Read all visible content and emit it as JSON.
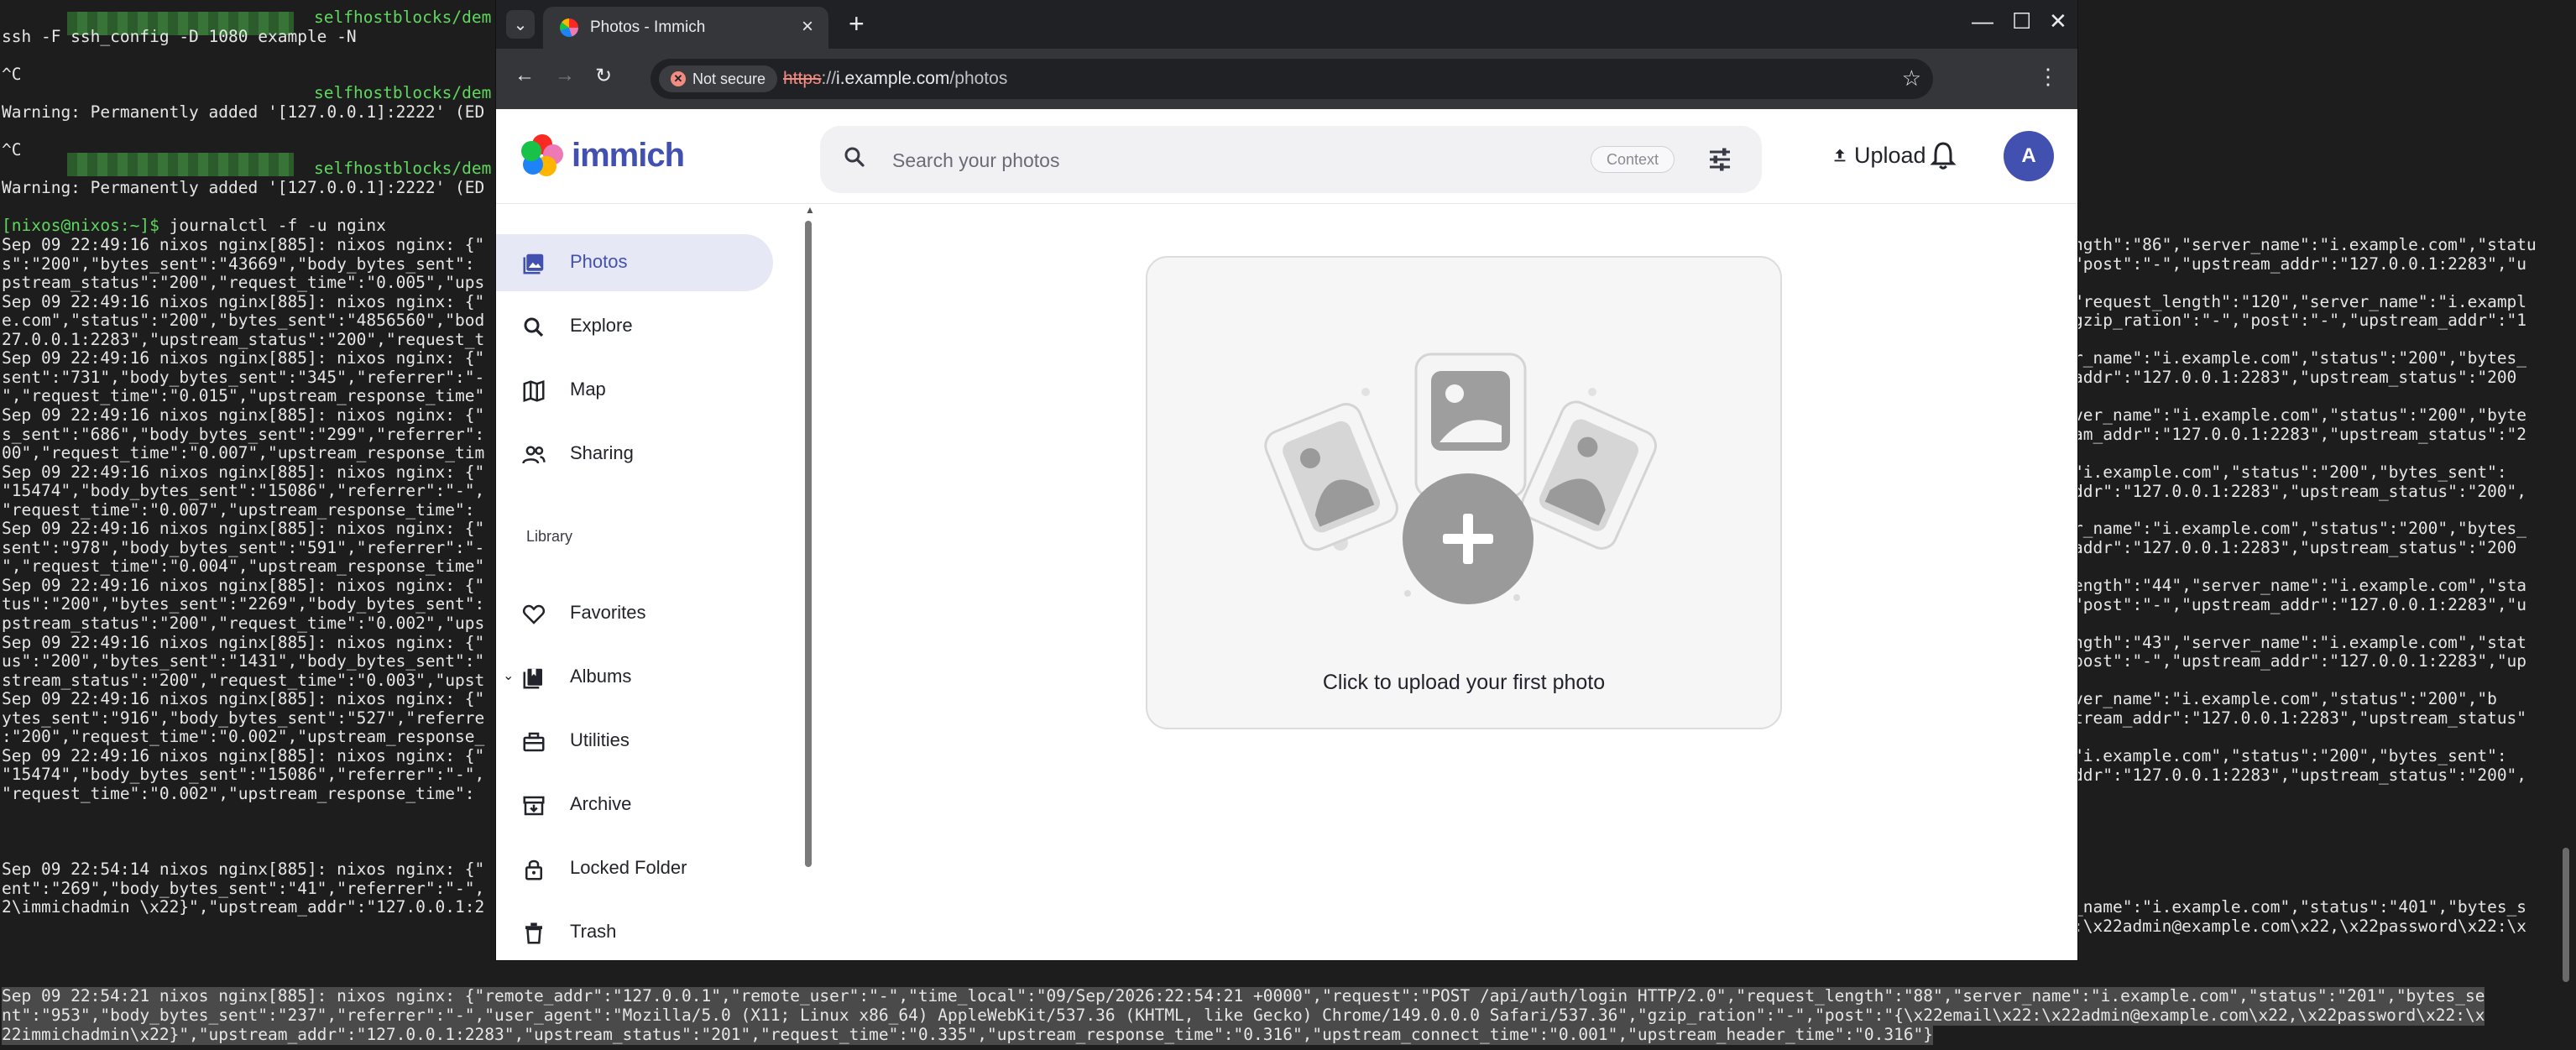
{
  "terminal": {
    "lines": [
      "ssh -F ssh_config -D 1080 example -N",
      "^C",
      "Warning: Permanently added '[127.0.0.1]:2222' (ED",
      "^C",
      "Warning: Permanently added '[127.0.0.1]:2222' (ED",
      "journalctl -f -u nginx",
      "Sep 09 22:49:16 nixos nginx[885]: nixos nginx: {\"",
      "s\":\"200\",\"bytes_sent\":\"43669\",\"body_bytes_sent\":",
      "pstream_status\":\"200\",\"request_time\":\"0.005\",\"ups",
      "Sep 09 22:49:16 nixos nginx[885]: nixos nginx: {\"",
      "e.com\",\"status\":\"200\",\"bytes_sent\":\"4856560\",\"bod",
      "27.0.0.1:2283\",\"upstream_status\":\"200\",\"request_t",
      "Sep 09 22:49:16 nixos nginx[885]: nixos nginx: {\"",
      "sent\":\"731\",\"body_bytes_sent\":\"345\",\"referrer\":\"-",
      "\",\"request_time\":\"0.015\",\"upstream_response_time\"",
      "Sep 09 22:49:16 nixos nginx[885]: nixos nginx: {\"",
      "s_sent\":\"686\",\"body_bytes_sent\":\"299\",\"referrer\":",
      "00\",\"request_time\":\"0.007\",\"upstream_response_tim",
      "Sep 09 22:49:16 nixos nginx[885]: nixos nginx: {\"",
      "\"15474\",\"body_bytes_sent\":\"15086\",\"referrer\":\"-\",",
      "\"request_time\":\"0.007\",\"upstream_response_time\":",
      "Sep 09 22:49:16 nixos nginx[885]: nixos nginx: {\"",
      "sent\":\"978\",\"body_bytes_sent\":\"591\",\"referrer\":\"-",
      "\",\"request_time\":\"0.004\",\"upstream_response_time\"",
      "Sep 09 22:49:16 nixos nginx[885]: nixos nginx: {\"",
      "tus\":\"200\",\"bytes_sent\":\"2269\",\"body_bytes_sent\":",
      "pstream_status\":\"200\",\"request_time\":\"0.002\",\"ups",
      "Sep 09 22:49:16 nixos nginx[885]: nixos nginx: {\"",
      "us\":\"200\",\"bytes_sent\":\"1431\",\"body_bytes_sent\":\"",
      "stream_status\":\"200\",\"request_time\":\"0.003\",\"upst",
      "Sep 09 22:49:16 nixos nginx[885]: nixos nginx: {\"",
      "ytes_sent\":\"916\",\"body_bytes_sent\":\"527\",\"referre",
      ":\"200\",\"request_time\":\"0.002\",\"upstream_response_",
      "Sep 09 22:49:16 nixos nginx[885]: nixos nginx: {\"",
      "\"15474\",\"body_bytes_sent\":\"15086\",\"referrer\":\"-\",",
      "\"request_time\":\"0.002\",\"upstream_response_time\":",
      "Sep 09 22:54:14 nixos nginx[885]: nixos nginx: {\"",
      "ent\":\"269\",\"body_bytes_sent\":\"41\",\"referrer\":\"-\",",
      "2\\immichadmin \\x22}\",\"upstream_addr\":\"127.0.0.1:2"
    ],
    "prompt_user": "[nixos@nixos:~]$",
    "green_host_1": "selfhostblocks/dem",
    "green_host_2": "selfhostblocks/dem",
    "right_lines": [
      "ngth\":\"86\",\"server_name\":\"i.example.com\",\"statu",
      "\"post\":\"-\",\"upstream_addr\":\"127.0.0.1:2283\",\"u",
      "\"request_length\":\"120\",\"server_name\":\"i.exampl",
      "gzip_ration\":\"-\",\"post\":\"-\",\"upstream_addr\":\"1",
      "r_name\":\"i.example.com\",\"status\":\"200\",\"bytes_",
      "addr\":\"127.0.0.1:2283\",\"upstream_status\":\"200",
      "ver_name\":\"i.example.com\",\"status\":\"200\",\"byte",
      "am_addr\":\"127.0.0.1:2283\",\"upstream_status\":\"2",
      "\"i.example.com\",\"status\":\"200\",\"bytes_sent\":",
      "ddr\":\"127.0.0.1:2283\",\"upstream_status\":\"200\",",
      "r_name\":\"i.example.com\",\"status\":\"200\",\"bytes_",
      "addr\":\"127.0.0.1:2283\",\"upstream_status\":\"200",
      "ength\":\"44\",\"server_name\":\"i.example.com\",\"sta",
      "\"post\":\"-\",\"upstream_addr\":\"127.0.0.1:2283\",\"u",
      "ngth\":\"43\",\"server_name\":\"i.example.com\",\"stat",
      "post\":\"-\",\"upstream_addr\":\"127.0.0.1:2283\",\"up",
      "ver_name\":\"i.example.com\",\"status\":\"200\",\"b",
      "tream_addr\":\"127.0.0.1:2283\",\"upstream_status\"",
      "\"i.example.com\",\"status\":\"200\",\"bytes_sent\":",
      "ddr\":\"127.0.0.1:2283\",\"upstream_status\":\"200\",",
      "_name\":\"i.example.com\",\"status\":\"401\",\"bytes_s",
      ":\\x22admin@example.com\\x22,\\x22password\\x22:\\x"
    ],
    "highlight_lines": [
      "Sep 09 22:54:21 nixos nginx[885]: nixos nginx: {\"remote_addr\":\"127.0.0.1\",\"remote_user\":\"-\",\"time_local\":\"09/Sep/2026:22:54:21 +0000\",\"request\":\"POST /api/auth/login HTTP/2.0\",\"request_length\":\"88\",\"server_name\":\"i.example.com\",\"status\":\"201\",\"bytes_se",
      "nt\":\"953\",\"body_bytes_sent\":\"237\",\"referrer\":\"-\",\"user_agent\":\"Mozilla/5.0 (X11; Linux x86_64) AppleWebKit/537.36 (KHTML, like Gecko) Chrome/149.0.0.0 Safari/537.36\",\"gzip_ration\":\"-\",\"post\":\"{\\x22email\\x22:\\x22admin@example.com\\x22,\\x22password\\x22:\\x",
      "22immichadmin\\x22}\",\"upstream_addr\":\"127.0.0.1:2283\",\"upstream_status\":\"201\",\"request_time\":\"0.335\",\"upstream_response_time\":\"0.316\",\"upstream_connect_time\":\"0.001\",\"upstream_header_time\":\"0.316\"}"
    ]
  },
  "browser": {
    "tab_title": "Photos - Immich",
    "security_chip": "Not secure",
    "url_protocol": "https",
    "url_sep": "://",
    "url_host": "i.example.com",
    "url_path": "/photos"
  },
  "app": {
    "logo_text": "immich",
    "search_placeholder": "Search your photos",
    "context_label": "Context",
    "upload_label": "Upload",
    "avatar_initial": "A",
    "nav": [
      {
        "label": "Photos",
        "icon": "photos-icon"
      },
      {
        "label": "Explore",
        "icon": "explore-icon"
      },
      {
        "label": "Map",
        "icon": "map-icon"
      },
      {
        "label": "Sharing",
        "icon": "sharing-icon"
      }
    ],
    "library_heading": "Library",
    "library_nav": [
      {
        "label": "Favorites",
        "icon": "heart-icon"
      },
      {
        "label": "Albums",
        "icon": "albums-icon"
      },
      {
        "label": "Utilities",
        "icon": "toolbox-icon"
      },
      {
        "label": "Archive",
        "icon": "archive-icon"
      },
      {
        "label": "Locked Folder",
        "icon": "lock-icon"
      },
      {
        "label": "Trash",
        "icon": "trash-icon"
      }
    ],
    "empty_state_text": "Click to upload your first photo",
    "accent_color": "#4250af"
  }
}
